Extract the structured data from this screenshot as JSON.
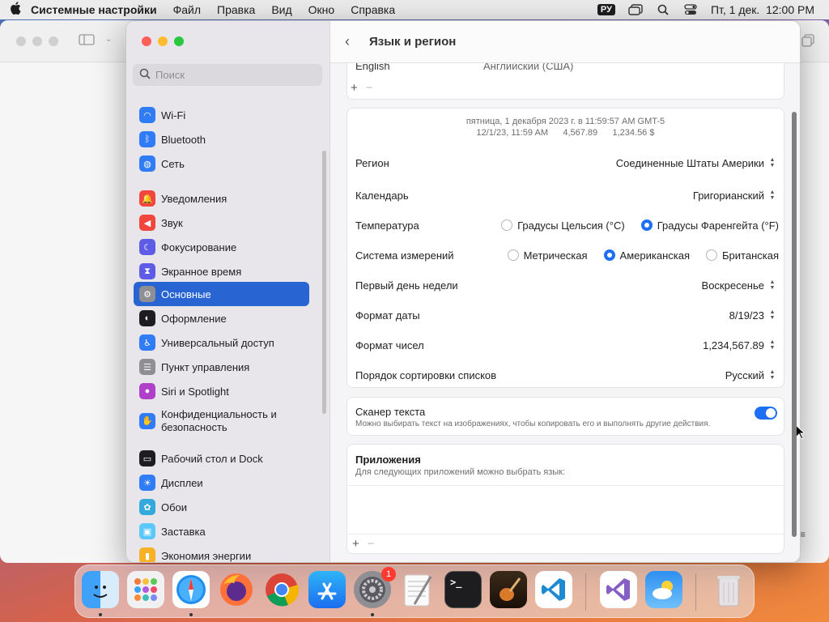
{
  "menubar": {
    "app_name": "Системные настройки",
    "items": [
      "Файл",
      "Правка",
      "Вид",
      "Окно",
      "Справка"
    ],
    "input_source": "РУ",
    "clock": "Пт, 1 дек.  12:00 PM"
  },
  "sidebar": {
    "search_placeholder": "Поиск",
    "items": [
      {
        "label": "Wi-Fi",
        "icon": "wifi-icon",
        "color": "#2f7cf6"
      },
      {
        "label": "Bluetooth",
        "icon": "bluetooth-icon",
        "color": "#2f7cf6"
      },
      {
        "label": "Сеть",
        "icon": "globe-icon",
        "color": "#2f7cf6"
      },
      {
        "label": "Уведомления",
        "icon": "bell-icon",
        "color": "#f2453d"
      },
      {
        "label": "Звук",
        "icon": "speaker-icon",
        "color": "#f2453d"
      },
      {
        "label": "Фокусирование",
        "icon": "moon-icon",
        "color": "#5e5ce6"
      },
      {
        "label": "Экранное время",
        "icon": "hourglass-icon",
        "color": "#5e5ce6"
      },
      {
        "label": "Основные",
        "icon": "gear-icon",
        "color": "#8e8e93"
      },
      {
        "label": "Оформление",
        "icon": "appearance-icon",
        "color": "#1d1d1f"
      },
      {
        "label": "Универсальный доступ",
        "icon": "accessibility-icon",
        "color": "#2f7cf6"
      },
      {
        "label": "Пункт управления",
        "icon": "control-center-icon",
        "color": "#8e8e93"
      },
      {
        "label": "Siri и Spotlight",
        "icon": "siri-icon",
        "color": "#b03fc9"
      },
      {
        "label": "Конфиденциальность и безопасность",
        "icon": "hand-icon",
        "color": "#2f7cf6"
      },
      {
        "label": "Рабочий стол и Dock",
        "icon": "dock-icon",
        "color": "#1d1d1f"
      },
      {
        "label": "Дисплеи",
        "icon": "sun-icon",
        "color": "#2f7cf6"
      },
      {
        "label": "Обои",
        "icon": "flower-icon",
        "color": "#34aadc"
      },
      {
        "label": "Заставка",
        "icon": "screensaver-icon",
        "color": "#5ac8fa"
      },
      {
        "label": "Экономия энергии",
        "icon": "battery-icon",
        "color": "#f7b125"
      }
    ]
  },
  "header": {
    "title": "Язык и регион",
    "back": "‹"
  },
  "languages": {
    "top_language": "English",
    "top_language_native": "Английский (США)"
  },
  "format": {
    "preview_line1": "пятница, 1 декабря 2023 г. в 11:59:57 AM GMT-5",
    "preview_line2": "12/1/23, 11:59 AM      4,567.89      1,234.56 $",
    "region_label": "Регион",
    "region_value": "Соединенные Штаты Америки",
    "calendar_label": "Календарь",
    "calendar_value": "Григорианский",
    "temperature_label": "Температура",
    "temperature_options": [
      "Градусы Цельсия (°C)",
      "Градусы Фаренгейта (°F)"
    ],
    "temperature_selected": "Градусы Фаренгейта (°F)",
    "measure_label": "Система измерений",
    "measure_options": [
      "Метрическая",
      "Американская",
      "Британская"
    ],
    "measure_selected": "Американская",
    "firstday_label": "Первый день недели",
    "firstday_value": "Воскресенье",
    "dateformat_label": "Формат даты",
    "dateformat_value": "8/19/23",
    "numformat_label": "Формат чисел",
    "numformat_value": "1,234,567.89",
    "sort_label": "Порядок сортировки списков",
    "sort_value": "Русский"
  },
  "live_text": {
    "title": "Сканер текста",
    "desc": "Можно выбирать текст на изображениях, чтобы копировать его и выполнять другие действия.",
    "enabled": true
  },
  "apps": {
    "title": "Приложения",
    "desc": "Для следующих приложений можно выбрать язык:"
  },
  "controls": {
    "plus": "+",
    "minus": "−"
  },
  "dock": {
    "apps": [
      "Finder",
      "Launchpad",
      "Safari",
      "Firefox",
      "Chrome",
      "App Store",
      "System Settings",
      "TextEdit",
      "Terminal",
      "GarageBand",
      "VS Code",
      "Visual Studio",
      "Weather",
      "Trash"
    ],
    "settings_badge": "1"
  }
}
